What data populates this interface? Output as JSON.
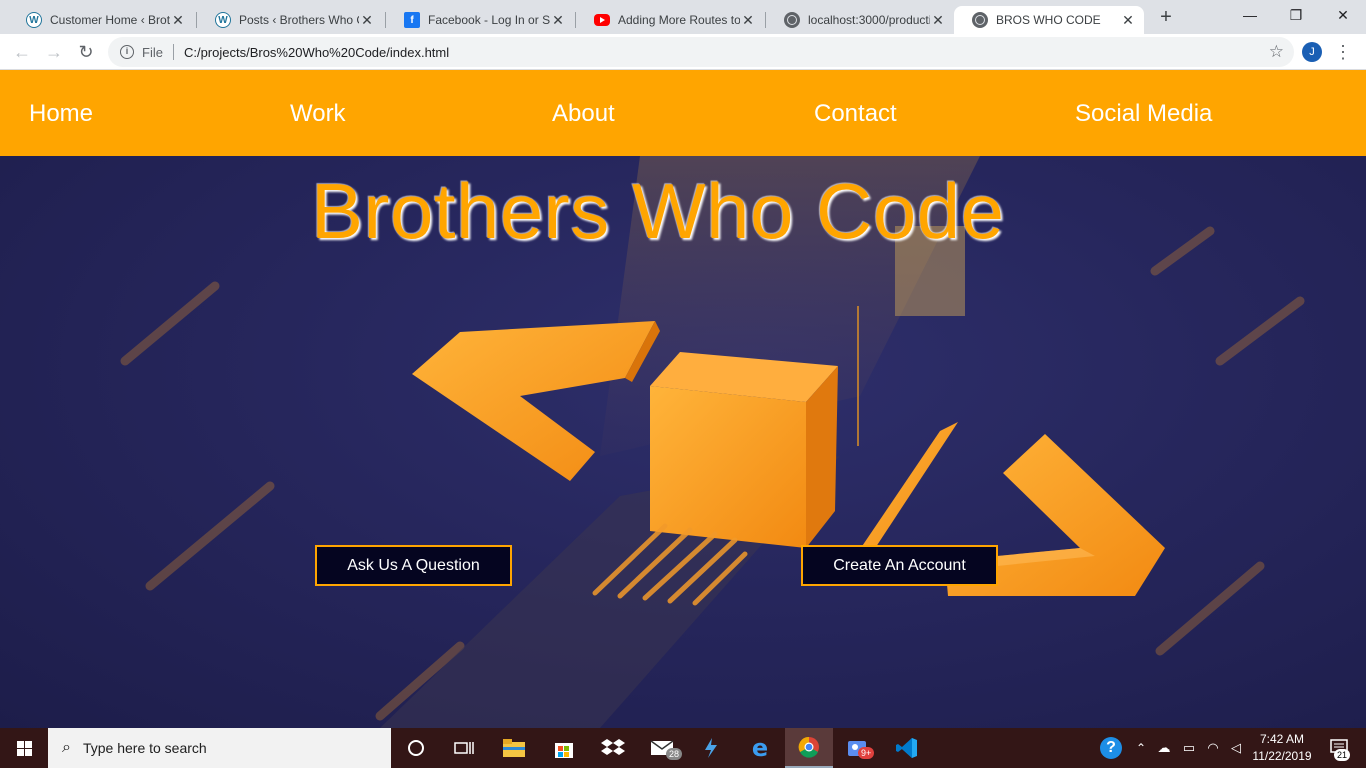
{
  "browser": {
    "tabs": [
      {
        "title": "Customer Home ‹ Broth",
        "favicon": "wordpress-icon",
        "active": false
      },
      {
        "title": "Posts ‹ Brothers Who Co",
        "favicon": "wordpress-icon",
        "active": false
      },
      {
        "title": "Facebook - Log In or Si",
        "favicon": "facebook-icon",
        "active": false
      },
      {
        "title": "Adding More Routes to",
        "favicon": "youtube-icon",
        "active": false
      },
      {
        "title": "localhost:3000/producti",
        "favicon": "globe-icon",
        "active": false
      },
      {
        "title": "BROS WHO CODE",
        "favicon": "globe-icon",
        "active": true
      }
    ],
    "new_tab": "+",
    "scheme_label": "File",
    "url": "C:/projects/Bros%20Who%20Code/index.html",
    "profile_initial": "J"
  },
  "page": {
    "nav": [
      "Home",
      "Work",
      "About",
      "Contact",
      "Social Media"
    ],
    "title": "Brothers Who Code",
    "buttons": {
      "ask": "Ask Us A Question",
      "create": "Create An Account"
    },
    "colors": {
      "accent": "#ffa500",
      "background": "#26265c",
      "button_bg": "#050520"
    }
  },
  "taskbar": {
    "search_placeholder": "Type here to search",
    "mail_badge": "28",
    "app_badge": "9+",
    "time": "7:42 AM",
    "date": "11/22/2019",
    "notifications": "21"
  }
}
